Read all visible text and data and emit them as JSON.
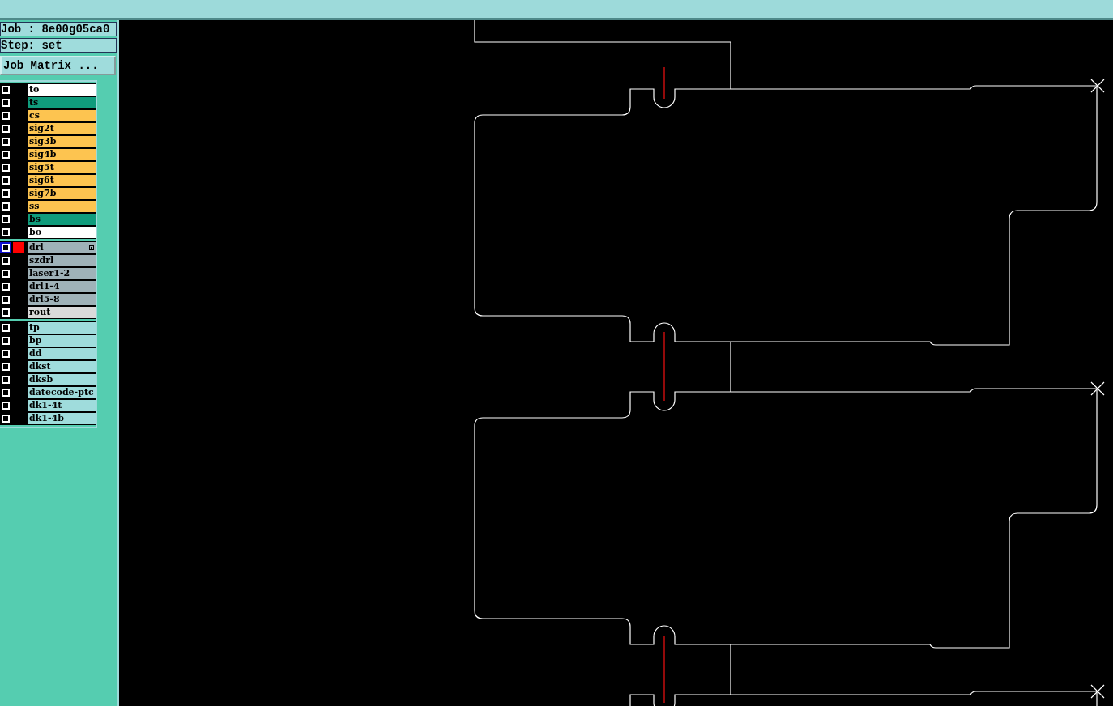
{
  "job": {
    "label": "Job : 8e00g05ca0"
  },
  "step": {
    "label": "Step: set"
  },
  "job_matrix_button": "Job Matrix ...",
  "layer_groups": [
    {
      "layers": [
        {
          "name": "to",
          "color": "#ffffff",
          "checked": false,
          "selected": false
        },
        {
          "name": "ts",
          "color": "#109c7c",
          "checked": false,
          "selected": false
        },
        {
          "name": "cs",
          "color": "#fdc450",
          "checked": false,
          "selected": false
        },
        {
          "name": "sig2t",
          "color": "#fdc450",
          "checked": false,
          "selected": false
        },
        {
          "name": "sig3b",
          "color": "#fdc450",
          "checked": false,
          "selected": false
        },
        {
          "name": "sig4b",
          "color": "#fdc450",
          "checked": false,
          "selected": false
        },
        {
          "name": "sig5t",
          "color": "#fdc450",
          "checked": false,
          "selected": false
        },
        {
          "name": "sig6t",
          "color": "#fdc450",
          "checked": false,
          "selected": false
        },
        {
          "name": "sig7b",
          "color": "#fdc450",
          "checked": false,
          "selected": false
        },
        {
          "name": "ss",
          "color": "#fdc450",
          "checked": false,
          "selected": false
        },
        {
          "name": "bs",
          "color": "#109c7c",
          "checked": false,
          "selected": false
        },
        {
          "name": "bo",
          "color": "#ffffff",
          "checked": false,
          "selected": false
        }
      ]
    },
    {
      "layers": [
        {
          "name": "drl",
          "color": "#9fb2b8",
          "checked": false,
          "selected": true
        },
        {
          "name": "szdrl",
          "color": "#9fb2b8",
          "checked": false,
          "selected": false
        },
        {
          "name": "laser1-2",
          "color": "#9fb2b8",
          "checked": false,
          "selected": false
        },
        {
          "name": "drl1-4",
          "color": "#9fb2b8",
          "checked": false,
          "selected": false
        },
        {
          "name": "drl5-8",
          "color": "#9fb2b8",
          "checked": false,
          "selected": false
        },
        {
          "name": "rout",
          "color": "#dadada",
          "checked": false,
          "selected": false
        }
      ]
    },
    {
      "layers": [
        {
          "name": "tp",
          "color": "#9fdcdc",
          "checked": false,
          "selected": false
        },
        {
          "name": "bp",
          "color": "#9fdcdc",
          "checked": false,
          "selected": false
        },
        {
          "name": "dd",
          "color": "#9fdcdc",
          "checked": false,
          "selected": false
        },
        {
          "name": "dkst",
          "color": "#9fdcdc",
          "checked": false,
          "selected": false
        },
        {
          "name": "dksb",
          "color": "#9fdcdc",
          "checked": false,
          "selected": false
        },
        {
          "name": "datecode-ptc",
          "color": "#9fdcdc",
          "checked": false,
          "selected": false
        },
        {
          "name": "dk1-4t",
          "color": "#9fdcdc",
          "checked": false,
          "selected": false
        },
        {
          "name": "dk1-4b",
          "color": "#9fdcdc",
          "checked": false,
          "selected": false
        }
      ]
    }
  ]
}
